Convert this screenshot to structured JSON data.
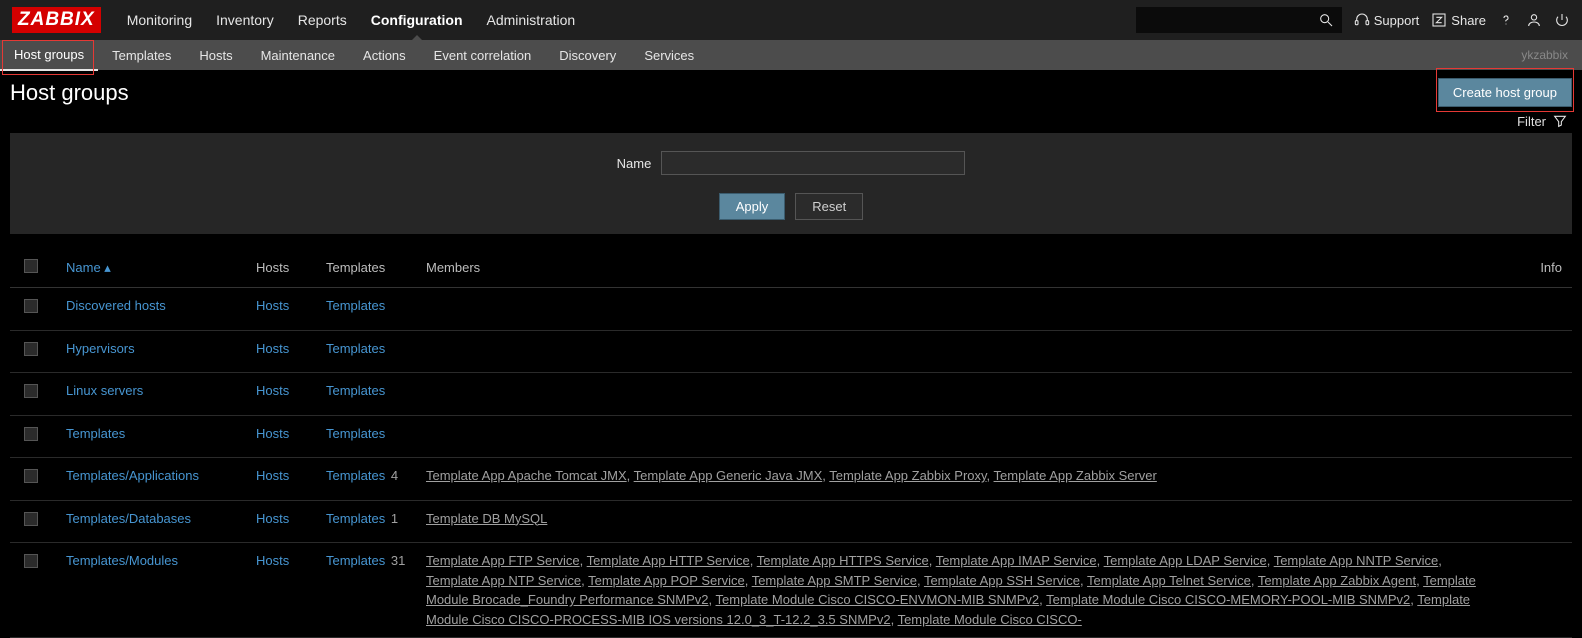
{
  "logo": "ZABBIX",
  "main_nav": [
    "Monitoring",
    "Inventory",
    "Reports",
    "Configuration",
    "Administration"
  ],
  "main_nav_active": 3,
  "top_right": {
    "support": "Support",
    "share": "Share"
  },
  "sub_nav": [
    "Host groups",
    "Templates",
    "Hosts",
    "Maintenance",
    "Actions",
    "Event correlation",
    "Discovery",
    "Services"
  ],
  "sub_nav_active": 0,
  "user": "ykzabbix",
  "page_title": "Host groups",
  "create_button": "Create host group",
  "filter": {
    "tab_label": "Filter",
    "name_label": "Name",
    "name_value": "",
    "apply": "Apply",
    "reset": "Reset"
  },
  "columns": {
    "name": "Name",
    "hosts": "Hosts",
    "templates": "Templates",
    "members": "Members",
    "info": "Info"
  },
  "rows": [
    {
      "name": "Discovered hosts",
      "hosts": "Hosts",
      "templates": "Templates",
      "tcount": "",
      "members": []
    },
    {
      "name": "Hypervisors",
      "hosts": "Hosts",
      "templates": "Templates",
      "tcount": "",
      "members": []
    },
    {
      "name": "Linux servers",
      "hosts": "Hosts",
      "templates": "Templates",
      "tcount": "",
      "members": []
    },
    {
      "name": "Templates",
      "hosts": "Hosts",
      "templates": "Templates",
      "tcount": "",
      "members": []
    },
    {
      "name": "Templates/Applications",
      "hosts": "Hosts",
      "templates": "Templates",
      "tcount": "4",
      "members": [
        "Template App Apache Tomcat JMX",
        "Template App Generic Java JMX",
        "Template App Zabbix Proxy",
        "Template App Zabbix Server"
      ]
    },
    {
      "name": "Templates/Databases",
      "hosts": "Hosts",
      "templates": "Templates",
      "tcount": "1",
      "members": [
        "Template DB MySQL"
      ]
    },
    {
      "name": "Templates/Modules",
      "hosts": "Hosts",
      "templates": "Templates",
      "tcount": "31",
      "members": [
        "Template App FTP Service",
        "Template App HTTP Service",
        "Template App HTTPS Service",
        "Template App IMAP Service",
        "Template App LDAP Service",
        "Template App NNTP Service",
        "Template App NTP Service",
        "Template App POP Service",
        "Template App SMTP Service",
        "Template App SSH Service",
        "Template App Telnet Service",
        "Template App Zabbix Agent",
        "Template Module Brocade_Foundry Performance SNMPv2",
        "Template Module Cisco CISCO-ENVMON-MIB SNMPv2",
        "Template Module Cisco CISCO-MEMORY-POOL-MIB SNMPv2",
        "Template Module Cisco CISCO-PROCESS-MIB IOS versions 12.0_3_T-12.2_3.5 SNMPv2",
        "Template Module Cisco CISCO-"
      ]
    }
  ]
}
